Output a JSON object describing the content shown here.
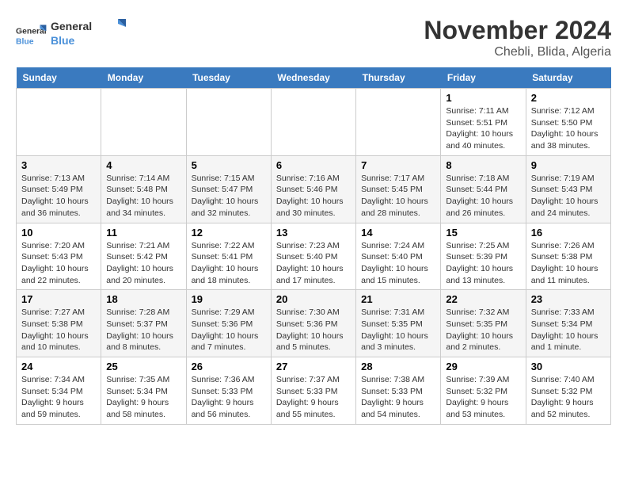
{
  "header": {
    "logo_line1": "General",
    "logo_line2": "Blue",
    "month_title": "November 2024",
    "location": "Chebli, Blida, Algeria"
  },
  "days_of_week": [
    "Sunday",
    "Monday",
    "Tuesday",
    "Wednesday",
    "Thursday",
    "Friday",
    "Saturday"
  ],
  "weeks": [
    {
      "days": [
        {
          "num": "",
          "info": ""
        },
        {
          "num": "",
          "info": ""
        },
        {
          "num": "",
          "info": ""
        },
        {
          "num": "",
          "info": ""
        },
        {
          "num": "",
          "info": ""
        },
        {
          "num": "1",
          "info": "Sunrise: 7:11 AM\nSunset: 5:51 PM\nDaylight: 10 hours and 40 minutes."
        },
        {
          "num": "2",
          "info": "Sunrise: 7:12 AM\nSunset: 5:50 PM\nDaylight: 10 hours and 38 minutes."
        }
      ]
    },
    {
      "days": [
        {
          "num": "3",
          "info": "Sunrise: 7:13 AM\nSunset: 5:49 PM\nDaylight: 10 hours and 36 minutes."
        },
        {
          "num": "4",
          "info": "Sunrise: 7:14 AM\nSunset: 5:48 PM\nDaylight: 10 hours and 34 minutes."
        },
        {
          "num": "5",
          "info": "Sunrise: 7:15 AM\nSunset: 5:47 PM\nDaylight: 10 hours and 32 minutes."
        },
        {
          "num": "6",
          "info": "Sunrise: 7:16 AM\nSunset: 5:46 PM\nDaylight: 10 hours and 30 minutes."
        },
        {
          "num": "7",
          "info": "Sunrise: 7:17 AM\nSunset: 5:45 PM\nDaylight: 10 hours and 28 minutes."
        },
        {
          "num": "8",
          "info": "Sunrise: 7:18 AM\nSunset: 5:44 PM\nDaylight: 10 hours and 26 minutes."
        },
        {
          "num": "9",
          "info": "Sunrise: 7:19 AM\nSunset: 5:43 PM\nDaylight: 10 hours and 24 minutes."
        }
      ]
    },
    {
      "days": [
        {
          "num": "10",
          "info": "Sunrise: 7:20 AM\nSunset: 5:43 PM\nDaylight: 10 hours and 22 minutes."
        },
        {
          "num": "11",
          "info": "Sunrise: 7:21 AM\nSunset: 5:42 PM\nDaylight: 10 hours and 20 minutes."
        },
        {
          "num": "12",
          "info": "Sunrise: 7:22 AM\nSunset: 5:41 PM\nDaylight: 10 hours and 18 minutes."
        },
        {
          "num": "13",
          "info": "Sunrise: 7:23 AM\nSunset: 5:40 PM\nDaylight: 10 hours and 17 minutes."
        },
        {
          "num": "14",
          "info": "Sunrise: 7:24 AM\nSunset: 5:40 PM\nDaylight: 10 hours and 15 minutes."
        },
        {
          "num": "15",
          "info": "Sunrise: 7:25 AM\nSunset: 5:39 PM\nDaylight: 10 hours and 13 minutes."
        },
        {
          "num": "16",
          "info": "Sunrise: 7:26 AM\nSunset: 5:38 PM\nDaylight: 10 hours and 11 minutes."
        }
      ]
    },
    {
      "days": [
        {
          "num": "17",
          "info": "Sunrise: 7:27 AM\nSunset: 5:38 PM\nDaylight: 10 hours and 10 minutes."
        },
        {
          "num": "18",
          "info": "Sunrise: 7:28 AM\nSunset: 5:37 PM\nDaylight: 10 hours and 8 minutes."
        },
        {
          "num": "19",
          "info": "Sunrise: 7:29 AM\nSunset: 5:36 PM\nDaylight: 10 hours and 7 minutes."
        },
        {
          "num": "20",
          "info": "Sunrise: 7:30 AM\nSunset: 5:36 PM\nDaylight: 10 hours and 5 minutes."
        },
        {
          "num": "21",
          "info": "Sunrise: 7:31 AM\nSunset: 5:35 PM\nDaylight: 10 hours and 3 minutes."
        },
        {
          "num": "22",
          "info": "Sunrise: 7:32 AM\nSunset: 5:35 PM\nDaylight: 10 hours and 2 minutes."
        },
        {
          "num": "23",
          "info": "Sunrise: 7:33 AM\nSunset: 5:34 PM\nDaylight: 10 hours and 1 minute."
        }
      ]
    },
    {
      "days": [
        {
          "num": "24",
          "info": "Sunrise: 7:34 AM\nSunset: 5:34 PM\nDaylight: 9 hours and 59 minutes."
        },
        {
          "num": "25",
          "info": "Sunrise: 7:35 AM\nSunset: 5:34 PM\nDaylight: 9 hours and 58 minutes."
        },
        {
          "num": "26",
          "info": "Sunrise: 7:36 AM\nSunset: 5:33 PM\nDaylight: 9 hours and 56 minutes."
        },
        {
          "num": "27",
          "info": "Sunrise: 7:37 AM\nSunset: 5:33 PM\nDaylight: 9 hours and 55 minutes."
        },
        {
          "num": "28",
          "info": "Sunrise: 7:38 AM\nSunset: 5:33 PM\nDaylight: 9 hours and 54 minutes."
        },
        {
          "num": "29",
          "info": "Sunrise: 7:39 AM\nSunset: 5:32 PM\nDaylight: 9 hours and 53 minutes."
        },
        {
          "num": "30",
          "info": "Sunrise: 7:40 AM\nSunset: 5:32 PM\nDaylight: 9 hours and 52 minutes."
        }
      ]
    }
  ]
}
